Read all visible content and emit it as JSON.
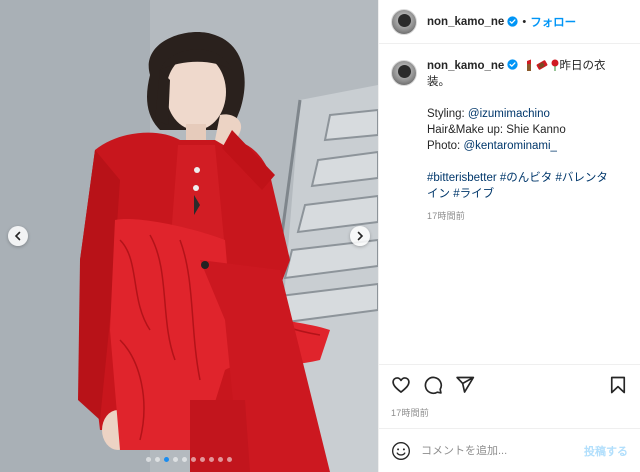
{
  "post": {
    "username": "non_kamo_ne",
    "follow_label": "フォロー",
    "separator": "•",
    "caption": {
      "line1": "昨日の衣",
      "line2": "装。",
      "styling_prefix": "Styling: ",
      "styling_mention": "@izumimachino",
      "hair_makeup": "Hair&Make up: Shie Kanno",
      "photo_prefix": "Photo: ",
      "photo_mention": "@kentarominami_",
      "tags_line1": "#bitterisbetter #のんビタ #バレンタ",
      "tags_line2": "イン #ライブ",
      "time": "17時間前"
    },
    "timestamp": "17時間前",
    "comment_placeholder": "コメントを追加...",
    "post_button": "投稿する"
  },
  "carousel": {
    "total": 10,
    "active_index": 2
  },
  "colors": {
    "accent": "#0095f6",
    "link": "#00376b",
    "muted": "#8e8e8e",
    "outfit_red": "#d01a22"
  },
  "icons": {
    "like": "heart-icon",
    "comment": "comment-bubble-icon",
    "share": "paper-plane-icon",
    "save": "bookmark-icon",
    "emoji": "smiley-icon",
    "verified": "verified-badge-icon",
    "prev": "chevron-left-icon",
    "next": "chevron-right-icon"
  }
}
